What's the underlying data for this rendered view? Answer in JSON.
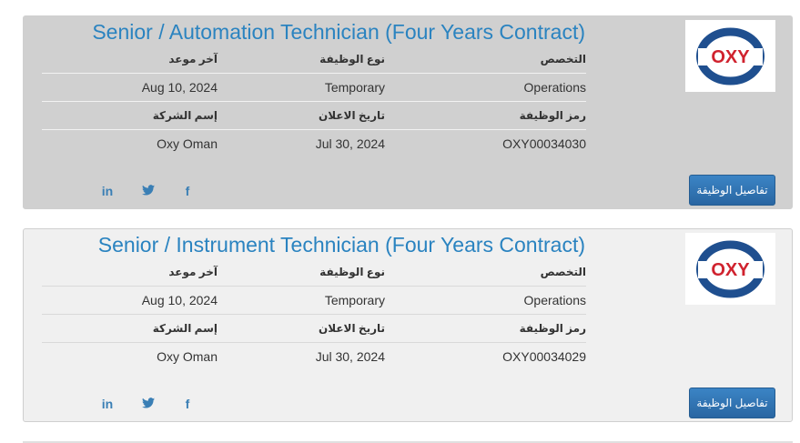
{
  "labels": {
    "specialty": "التخصص",
    "job_type": "نوع الوظيفة",
    "deadline": "آخر موعد",
    "job_code": "رمز الوظيفة",
    "post_date": "تاريخ الاعلان",
    "company": "إسم الشركة"
  },
  "jobs": [
    {
      "title": "Senior / Automation Technician (Four Years Contract)",
      "logo_text": "OXY",
      "specialty": "Operations",
      "job_type": "Temporary",
      "deadline": "Aug 10, 2024",
      "job_code": "OXY00034030",
      "post_date": "Jul 30, 2024",
      "company": "Oxy Oman",
      "details_button": "تفاصيل الوظيفة",
      "social": {
        "linkedin": "in",
        "twitter": "🐦",
        "facebook": "f"
      }
    },
    {
      "title": "Senior / Instrument Technician (Four Years Contract)",
      "logo_text": "OXY",
      "specialty": "Operations",
      "job_type": "Temporary",
      "deadline": "Aug 10, 2024",
      "job_code": "OXY00034029",
      "post_date": "Jul 30, 2024",
      "company": "Oxy Oman",
      "details_button": "تفاصيل الوظيفة",
      "social": {
        "linkedin": "in",
        "twitter": "🐦",
        "facebook": "f"
      }
    }
  ],
  "colors": {
    "title": "#2a83c0",
    "button": "#2f72b0",
    "logo_red": "#d0222e",
    "logo_blue": "#1f4f8f",
    "card_active_bg": "#d0d0d0",
    "card_bg": "#f0f0f0"
  }
}
